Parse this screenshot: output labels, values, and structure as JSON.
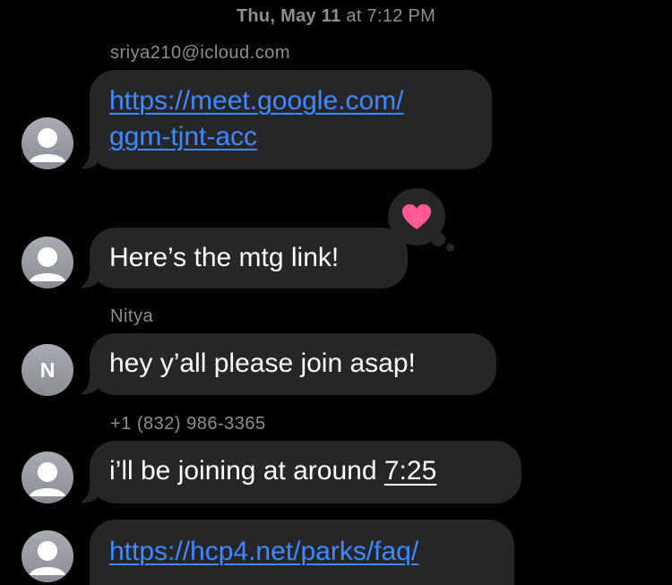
{
  "header": {
    "date": "Thu, May 11",
    "time_prefix": "at",
    "time": "7:12 PM"
  },
  "messages": [
    {
      "sender": "sriya210@icloud.com",
      "avatar": "person-silhouette-icon",
      "link_line1": "https://meet.google.com/",
      "link_line2": "ggm-tjnt-acc"
    },
    {
      "avatar": "person-silhouette-icon",
      "text": "Here’s the mtg link!",
      "tapback": "heart-icon"
    },
    {
      "sender": "Nitya",
      "avatar_initial": "N",
      "text": "hey y’all please join asap!"
    },
    {
      "sender": "+1 (832) 986-3365",
      "avatar": "person-silhouette-icon",
      "text_prefix": "i’ll be joining at around ",
      "text_time": "7:25"
    },
    {
      "avatar": "person-silhouette-icon",
      "link": "https://hcp4.net/parks/faq/"
    }
  ],
  "colors": {
    "background": "#000000",
    "bubble": "#262628",
    "link": "#3d8bff",
    "meta_text": "#8e8e93",
    "heart": "#ff5a96"
  }
}
